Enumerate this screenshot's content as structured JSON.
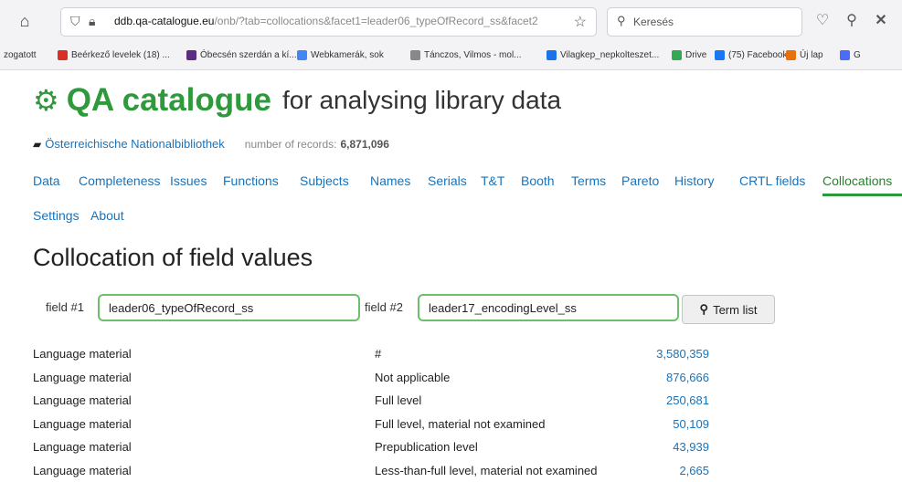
{
  "browser": {
    "url_host": "ddb.qa-catalogue.eu",
    "url_path": "/onb/?tab=collocations&facet1=leader06_typeOfRecord_ss&facet2",
    "search_placeholder": "Keresés",
    "bookmarks": [
      {
        "label": "zogatott",
        "color": "#ffffff"
      },
      {
        "label": "Beérkező levelek (18) ...",
        "color": "#d93025"
      },
      {
        "label": "Óbecsén szerdán a kí...",
        "color": "#5a2d82"
      },
      {
        "label": "Webkamerák, sok",
        "color": "#4285f4"
      },
      {
        "label": "Tánczos, Vilmos - mol...",
        "color": "#888888"
      },
      {
        "label": "Vilagkep_nepkolteszet...",
        "color": "#1a73e8"
      },
      {
        "label": "Drive",
        "color": "#34a853"
      },
      {
        "label": "(75) Facebook",
        "color": "#1877f2"
      },
      {
        "label": "Új lap",
        "color": "#e8710a"
      },
      {
        "label": "G",
        "color": "#4a6cf7"
      }
    ]
  },
  "app": {
    "logo_name": "QA catalogue",
    "logo_tagline": "for analysing library data",
    "library_name": "Österreichische Nationalbibliothek",
    "records_label": "number of records:",
    "records_value": "6,871,096"
  },
  "tabs": [
    "Data",
    "Completeness",
    "Issues",
    "Functions",
    "Subjects",
    "Names",
    "Serials",
    "T&T",
    "Booth",
    "Terms",
    "Pareto",
    "History",
    "CRTL fields",
    "Collocations",
    "Settings",
    "About"
  ],
  "active_tab": "Collocations",
  "page_title": "Collocation of field values",
  "form": {
    "field1_label": "field #1",
    "field1_value": "leader06_typeOfRecord_ss",
    "field2_label": "field #2",
    "field2_value": "leader17_encodingLevel_ss",
    "term_list_label": "Term list"
  },
  "results": [
    {
      "field1": "Language material",
      "field2": "#",
      "count": "3,580,359"
    },
    {
      "field1": "Language material",
      "field2": "Not applicable",
      "count": "876,666"
    },
    {
      "field1": "Language material",
      "field2": "Full level",
      "count": "250,681"
    },
    {
      "field1": "Language material",
      "field2": "Full level, material not examined",
      "count": "50,109"
    },
    {
      "field1": "Language material",
      "field2": "Prepublication level",
      "count": "43,939"
    },
    {
      "field1": "Language material",
      "field2": "Less-than-full level, material not examined",
      "count": "2,665"
    }
  ],
  "colors": {
    "brand": "#2e9a3c",
    "link": "#1a73b8",
    "field_border": "#6cc06c"
  }
}
